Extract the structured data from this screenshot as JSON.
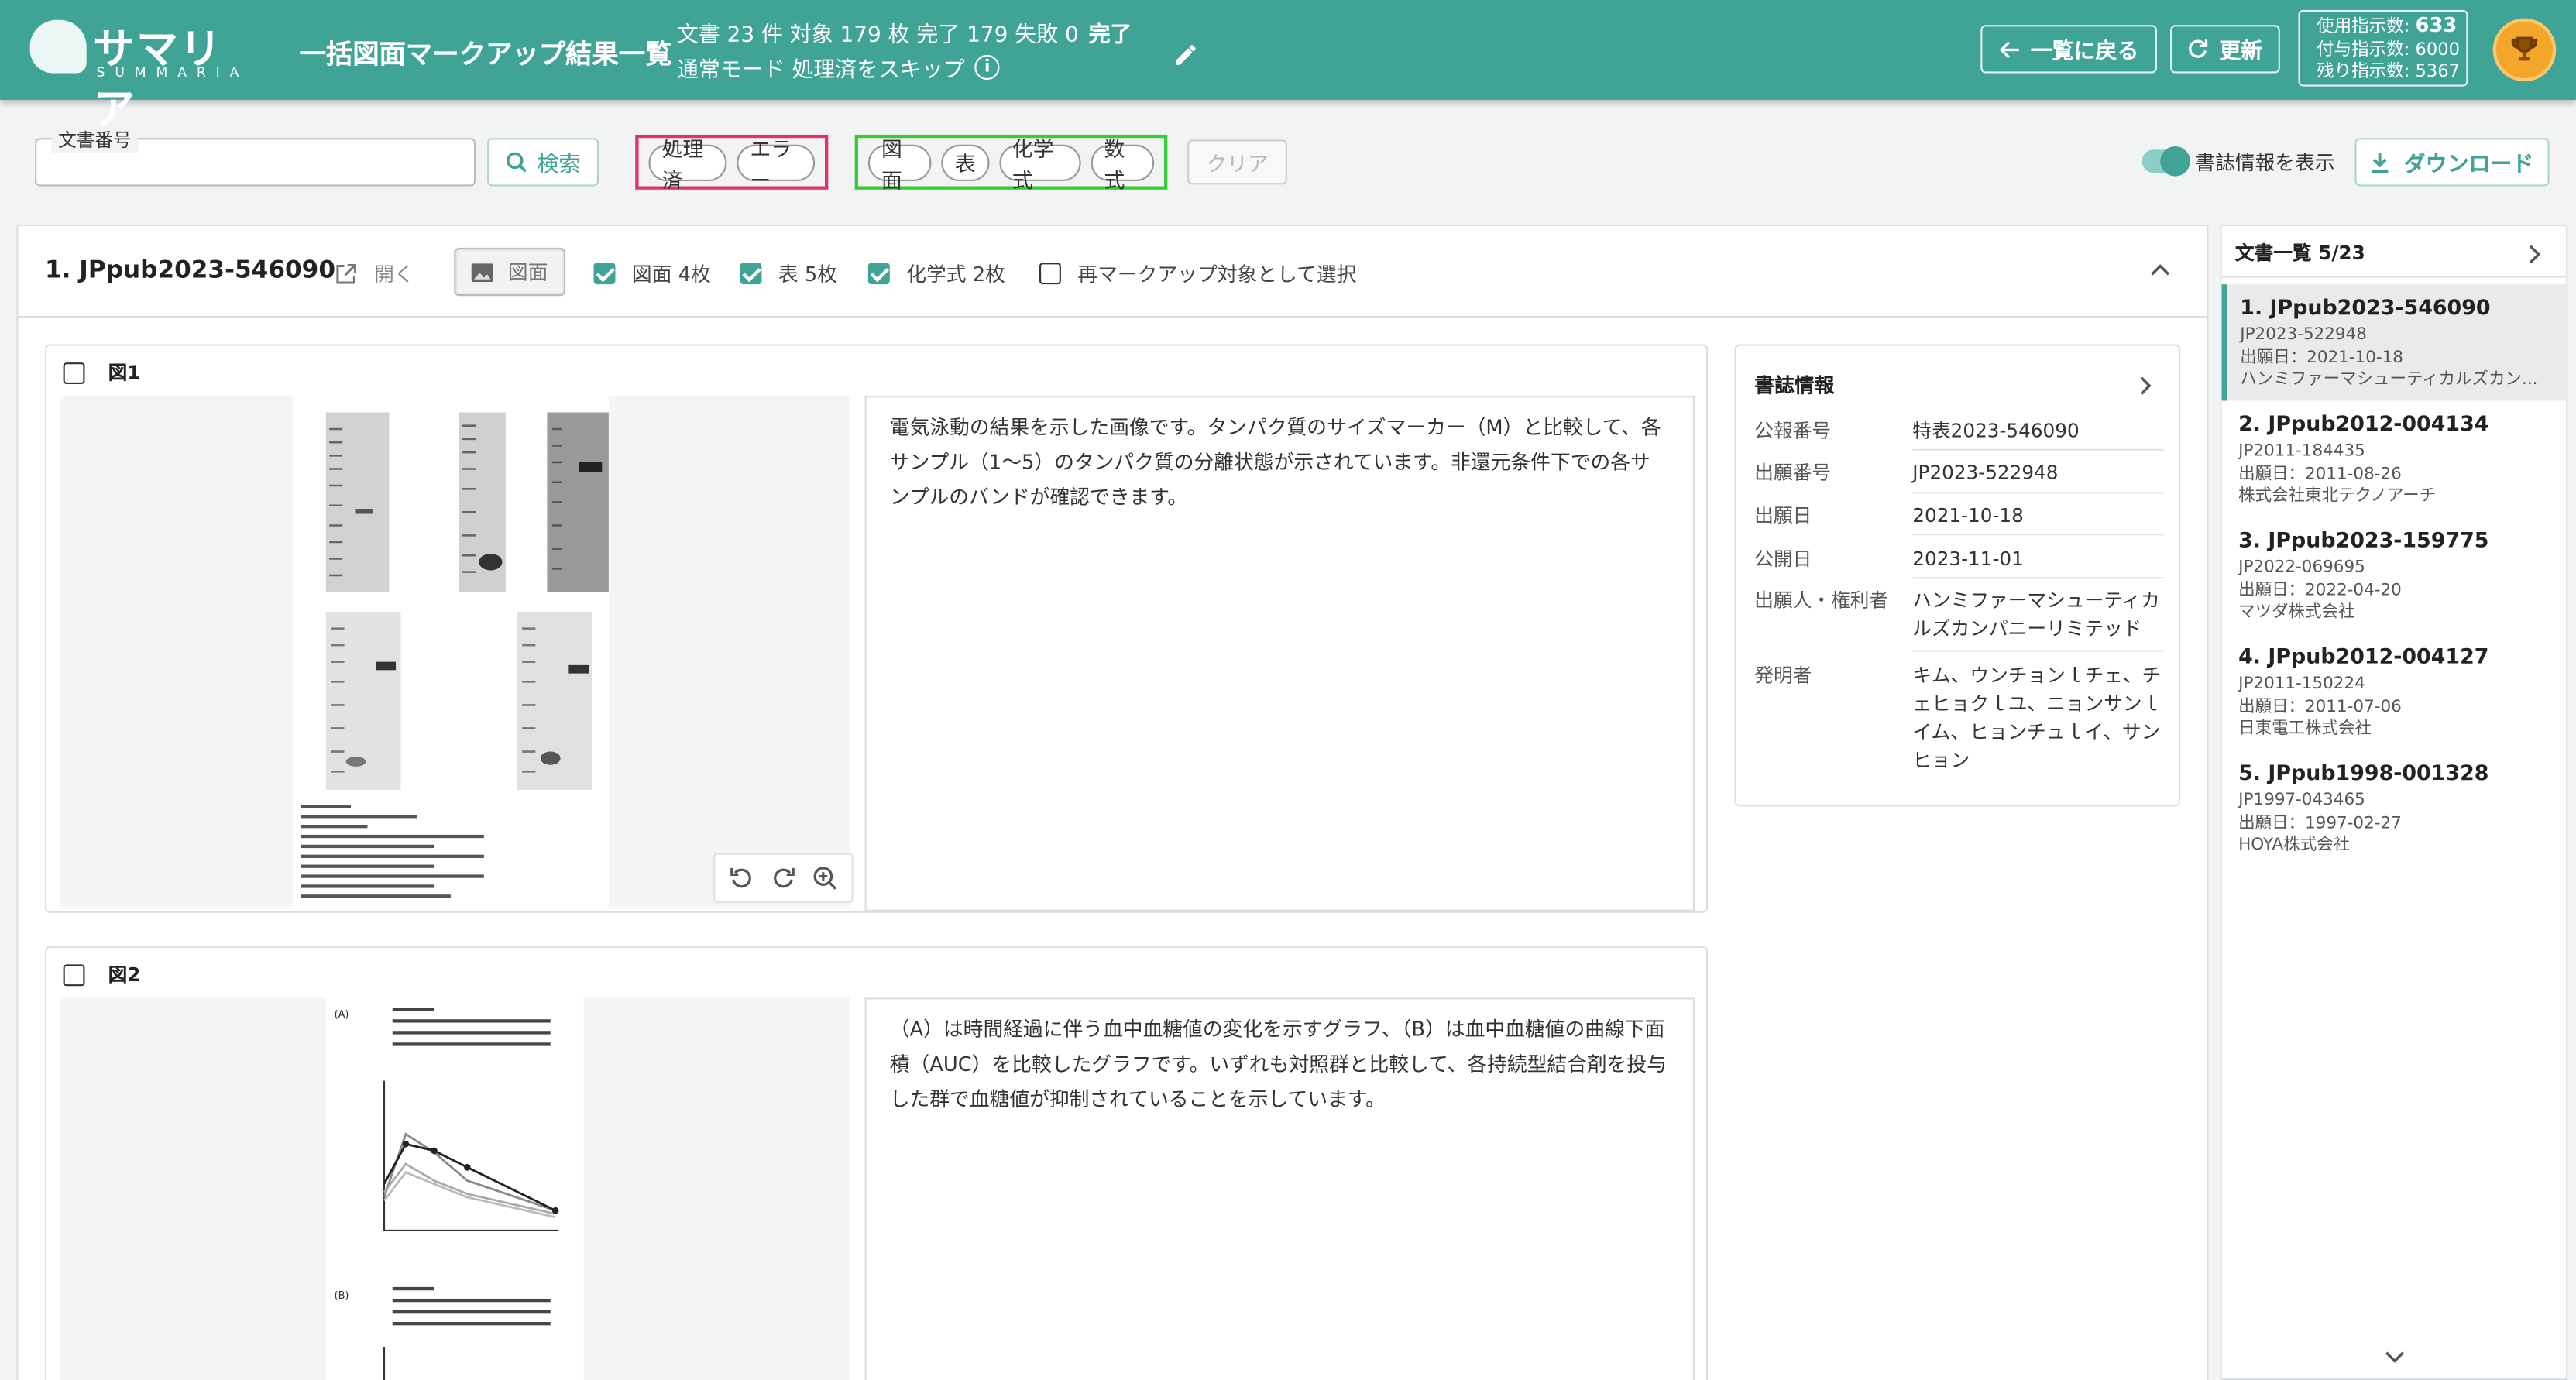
{
  "header": {
    "logo_jp": "サマリア",
    "logo_en": "SUMMARIA",
    "title": "一括図面マークアップ結果一覧",
    "stats": "文書 23 件 対象 179 枚 完了 179 失敗 0",
    "stats_status": "完了",
    "mode": "通常モード 処理済をスキップ",
    "back_label": "一覧に戻る",
    "refresh_label": "更新",
    "usage": {
      "used_label": "使用指示数:",
      "used_value": "633",
      "granted": "付与指示数: 6000",
      "remaining": "残り指示数: 5367"
    }
  },
  "toolbar": {
    "doc_number_label": "文書番号",
    "doc_number_value": "",
    "search_label": "検索",
    "status_chips": [
      "処理済",
      "エラー"
    ],
    "type_chips": [
      "図面",
      "表",
      "化学式",
      "数式"
    ],
    "clear_label": "クリア",
    "show_bib_label": "書誌情報を表示",
    "download_label": "ダウンロード"
  },
  "document": {
    "title": "1. JPpub2023-546090",
    "open_label": "開く",
    "figure_button": "図面",
    "filters": {
      "figures": "図面 4枚",
      "tables": "表 5枚",
      "chemical": "化学式 2枚",
      "reselect": "再マークアップ対象として選択"
    },
    "figures": [
      {
        "label": "図1",
        "description": "電気泳動の結果を示した画像です。タンパク質のサイズマーカー（M）と比較して、各サンプル（1〜5）のタンパク質の分離状態が示されています。非還元条件下での各サンプルのバンドが確認できます。"
      },
      {
        "label": "図2",
        "description": "（A）は時間経過に伴う血中血糖値の変化を示すグラフ、（B）は血中血糖値の曲線下面積（AUC）を比較したグラフです。いずれも対照群と比較して、各持続型結合剤を投与した群で血糖値が抑制されていることを示しています。"
      }
    ]
  },
  "bib": {
    "title": "書誌情報",
    "rows": [
      {
        "k": "公報番号",
        "v": "特表2023-546090"
      },
      {
        "k": "出願番号",
        "v": "JP2023-522948"
      },
      {
        "k": "出願日",
        "v": "2021-10-18"
      },
      {
        "k": "公開日",
        "v": "2023-11-01"
      },
      {
        "k": "出願人・権利者",
        "v": "ハンミファーマシューティカルズカンパニーリミテッド"
      },
      {
        "k": "発明者",
        "v": "キム、ウンチョンｌチェ、チェヒョクｌユ、ニョンサンｌイム、ヒョンチュｌイ、サンヒョン"
      }
    ]
  },
  "doc_list": {
    "title": "文書一覧 5/23",
    "items": [
      {
        "title": "1. JPpub2023-546090",
        "app": "JP2023-522948",
        "date": "出願日：2021-10-18",
        "applicant": "ハンミファーマシューティカルズカン..."
      },
      {
        "title": "2. JPpub2012-004134",
        "app": "JP2011-184435",
        "date": "出願日：2011-08-26",
        "applicant": "株式会社東北テクノアーチ"
      },
      {
        "title": "3. JPpub2023-159775",
        "app": "JP2022-069695",
        "date": "出願日：2022-04-20",
        "applicant": "マツダ株式会社"
      },
      {
        "title": "4. JPpub2012-004127",
        "app": "JP2011-150224",
        "date": "出願日：2011-07-06",
        "applicant": "日東電工株式会社"
      },
      {
        "title": "5. JPpub1998-001328",
        "app": "JP1997-043465",
        "date": "出願日：1997-02-27",
        "applicant": "HOYA株式会社"
      }
    ]
  },
  "colors": {
    "brand": "#3fa395",
    "status_box": "#e0336b",
    "type_box": "#33cc33"
  }
}
